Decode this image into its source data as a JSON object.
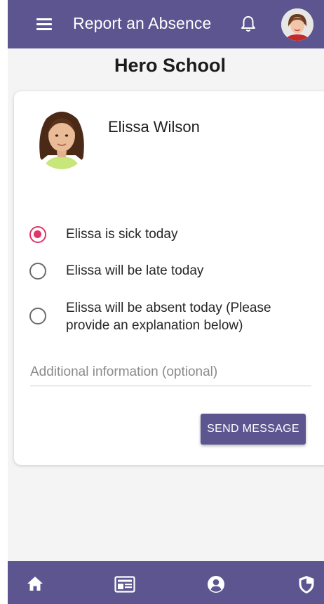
{
  "header": {
    "title": "Report an Absence",
    "menu_icon": "menu-icon",
    "bell_icon": "bell-icon",
    "avatar": "user-avatar"
  },
  "school": {
    "name": "Hero School"
  },
  "student": {
    "name": "Elissa Wilson",
    "photo": "student-photo"
  },
  "options": [
    {
      "label": "Elissa is sick today",
      "selected": true
    },
    {
      "label": "Elissa will be late today",
      "selected": false
    },
    {
      "label": "Elissa will be absent today (Please provide an explanation below)",
      "selected": false
    }
  ],
  "info": {
    "value": "",
    "placeholder": "Additional information (optional)"
  },
  "send_button": {
    "label": "SEND MESSAGE"
  },
  "bottom_nav": [
    {
      "icon": "home-icon"
    },
    {
      "icon": "news-icon"
    },
    {
      "icon": "account-icon"
    },
    {
      "icon": "shield-icon"
    }
  ],
  "colors": {
    "primary": "#5c5590",
    "accent": "#e0346a",
    "background": "#f4f4f4"
  }
}
